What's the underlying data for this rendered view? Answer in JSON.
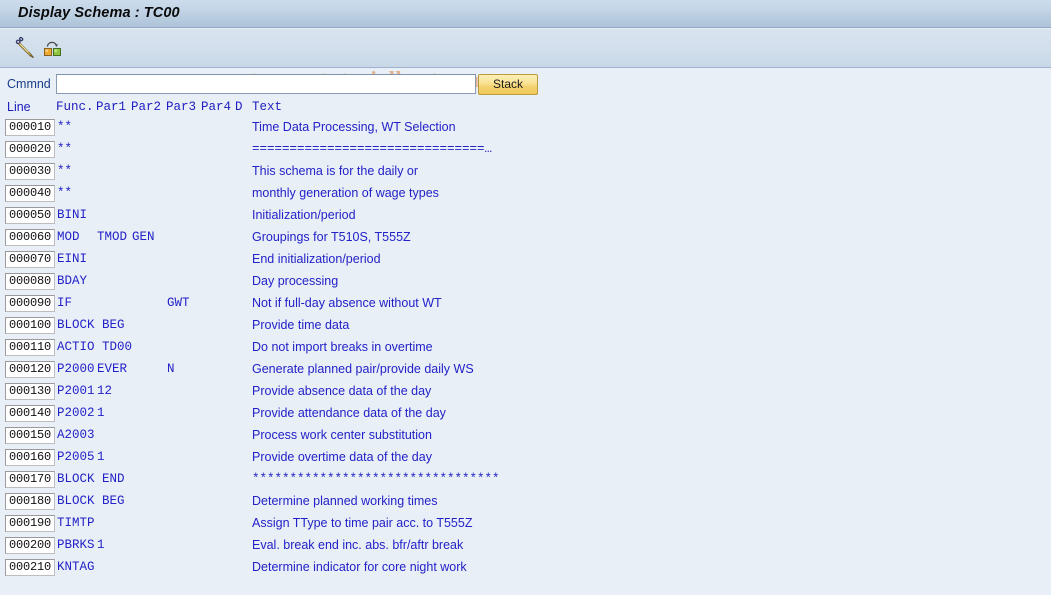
{
  "window": {
    "title": "Display Schema : TC00"
  },
  "toolbar": {
    "buttons": [
      {
        "name": "edit-pencil-icon",
        "label": ""
      },
      {
        "name": "structure-icon",
        "label": ""
      }
    ]
  },
  "watermark": {
    "copyright": "©",
    "text": "www.tutorialkart.com",
    "color": "#e2b089"
  },
  "command_bar": {
    "label": "Cmmnd",
    "value": "",
    "placeholder": "",
    "stack_label": "Stack"
  },
  "table": {
    "headers": {
      "line": "Line",
      "func": "Func.",
      "par1": "Par1",
      "par2": "Par2",
      "par3": "Par3",
      "par4": "Par4",
      "d": "D",
      "text": "Text"
    },
    "rows": [
      {
        "line": "000010",
        "func": "**",
        "par1": "",
        "par2": "",
        "par3": "",
        "par4": "",
        "d": "",
        "text": "Time Data Processing, WT Selection",
        "mono": false
      },
      {
        "line": "000020",
        "func": "**",
        "par1": "",
        "par2": "",
        "par3": "",
        "par4": "",
        "d": "",
        "text": "===============================…",
        "mono": true
      },
      {
        "line": "000030",
        "func": "**",
        "par1": "",
        "par2": "",
        "par3": "",
        "par4": "",
        "d": "",
        "text": "This schema is for the daily or",
        "mono": false
      },
      {
        "line": "000040",
        "func": "**",
        "par1": "",
        "par2": "",
        "par3": "",
        "par4": "",
        "d": "",
        "text": "monthly generation of wage types",
        "mono": false
      },
      {
        "line": "000050",
        "func": "BINI",
        "par1": "",
        "par2": "",
        "par3": "",
        "par4": "",
        "d": "",
        "text": "Initialization/period",
        "mono": false
      },
      {
        "line": "000060",
        "func": "MOD",
        "par1": "TMOD",
        "par2": "GEN",
        "par3": "",
        "par4": "",
        "d": "",
        "text": "Groupings for T510S, T555Z",
        "mono": false
      },
      {
        "line": "000070",
        "func": "EINI",
        "par1": "",
        "par2": "",
        "par3": "",
        "par4": "",
        "d": "",
        "text": "End initialization/period",
        "mono": false
      },
      {
        "line": "000080",
        "func": "BDAY",
        "par1": "",
        "par2": "",
        "par3": "",
        "par4": "",
        "d": "",
        "text": "Day processing",
        "mono": false
      },
      {
        "line": "000090",
        "func": "IF",
        "par1": "",
        "par2": "",
        "par3": "GWT",
        "par4": "",
        "d": "",
        "text": "Not if full-day absence without WT",
        "mono": false
      },
      {
        "line": "000100",
        "func": "BLOCK BEG",
        "par1": "",
        "par2": "",
        "par3": "",
        "par4": "",
        "d": "",
        "text": "Provide time data",
        "mono": false
      },
      {
        "line": "000110",
        "func": "ACTIO TD00",
        "par1": "",
        "par2": "",
        "par3": "",
        "par4": "",
        "d": "",
        "text": "Do not import breaks in overtime",
        "mono": false
      },
      {
        "line": "000120",
        "func": "P2000",
        "par1": "EVER",
        "par2": "",
        "par3": "N",
        "par4": "",
        "d": "",
        "text": "Generate planned pair/provide daily WS",
        "mono": false
      },
      {
        "line": "000130",
        "func": "P2001",
        "par1": "12",
        "par2": "",
        "par3": "",
        "par4": "",
        "d": "",
        "text": "Provide absence data of the day",
        "mono": false
      },
      {
        "line": "000140",
        "func": "P2002",
        "par1": "1",
        "par2": "",
        "par3": "",
        "par4": "",
        "d": "",
        "text": "Provide attendance data of the day",
        "mono": false
      },
      {
        "line": "000150",
        "func": "A2003",
        "par1": "",
        "par2": "",
        "par3": "",
        "par4": "",
        "d": "",
        "text": "Process work center substitution",
        "mono": false
      },
      {
        "line": "000160",
        "func": "P2005",
        "par1": "1",
        "par2": "",
        "par3": "",
        "par4": "",
        "d": "",
        "text": "Provide overtime data of the day",
        "mono": false
      },
      {
        "line": "000170",
        "func": "BLOCK END",
        "par1": "",
        "par2": "",
        "par3": "",
        "par4": "",
        "d": "",
        "text": "*********************************",
        "mono": true
      },
      {
        "line": "000180",
        "func": "BLOCK BEG",
        "par1": "",
        "par2": "",
        "par3": "",
        "par4": "",
        "d": "",
        "text": "Determine planned working times",
        "mono": false
      },
      {
        "line": "000190",
        "func": "TIMTP",
        "par1": "",
        "par2": "",
        "par3": "",
        "par4": "",
        "d": "",
        "text": "Assign TType to time pair acc. to T555Z",
        "mono": false
      },
      {
        "line": "000200",
        "func": "PBRKS",
        "par1": "1",
        "par2": "",
        "par3": "",
        "par4": "",
        "d": "",
        "text": "Eval. break end inc. abs. bfr/aftr break",
        "mono": false
      },
      {
        "line": "000210",
        "func": "KNTAG",
        "par1": "",
        "par2": "",
        "par3": "",
        "par4": "",
        "d": "",
        "text": "Determine indicator for core night work",
        "mono": false
      }
    ]
  },
  "colors": {
    "background": "#e9eff6",
    "title_bar": "#c2d4e6",
    "text_blue": "#2222c8",
    "label_blue": "#1b3c8c",
    "stack_button": "#f4d271"
  }
}
